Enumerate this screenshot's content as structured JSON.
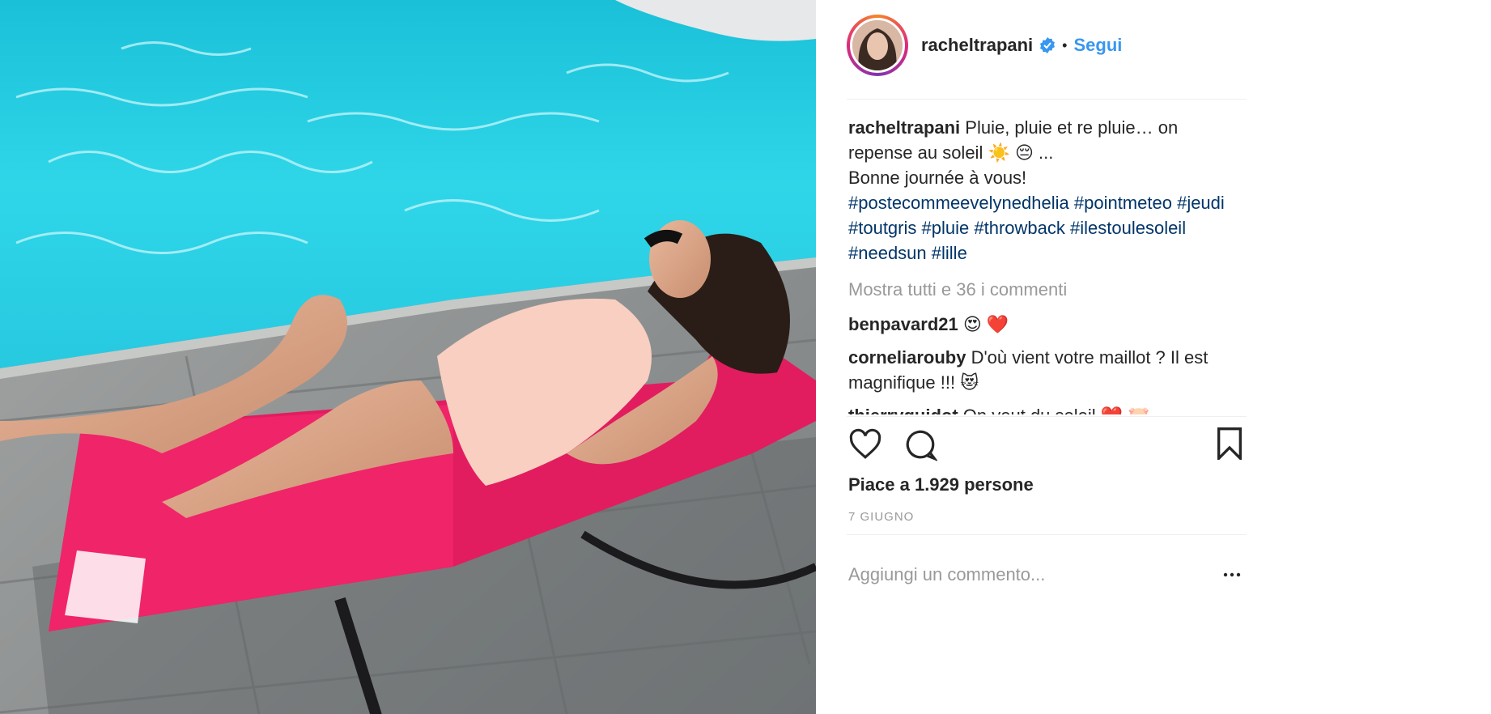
{
  "header": {
    "username": "racheltrapani",
    "separator": "•",
    "follow_label": "Segui"
  },
  "caption": {
    "username": "racheltrapani",
    "text_1": " Pluie, pluie et re pluie… on repense au soleil ",
    "emoji_1": "☀️",
    "emoji_2": "😔",
    "text_2": " ...",
    "text_3": "Bonne journée à vous!",
    "hashtags": [
      "#postecommeevelynedhelia",
      "#pointmeteo",
      "#jeudi",
      "#toutgris",
      "#pluie",
      "#throwback",
      "#ilestoulesoleil",
      "#needsun",
      "#lille"
    ]
  },
  "show_all_comments": "Mostra tutti e 36 i commenti",
  "comments": [
    {
      "user": "benpavard21",
      "text": " 😍 ❤️"
    },
    {
      "user": "corneliarouby",
      "text": " D'où vient votre maillot ? Il est magnifique !!! 😻"
    },
    {
      "user": "thierryguidot",
      "text": " On veut du soleil ❤️ 🐷"
    }
  ],
  "likes_text": "Piace a 1.929 persone",
  "date": "7 giugno",
  "add_comment_placeholder": "Aggiungi un commento...",
  "icons": {
    "like": "heart-icon",
    "comment": "comment-bubble-icon",
    "save": "bookmark-icon",
    "options": "more-options-icon",
    "verified": "verified-badge-icon"
  },
  "colors": {
    "accent": "#3897f0",
    "hashtag": "#003569",
    "muted": "#999999",
    "text": "#262626"
  }
}
